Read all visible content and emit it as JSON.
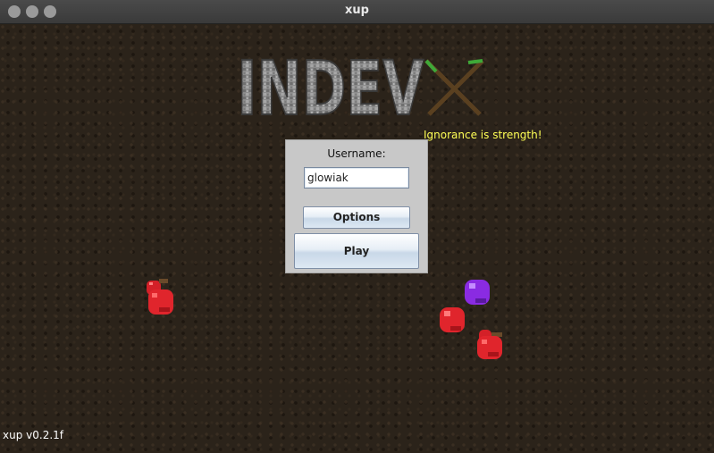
{
  "window": {
    "title": "xup"
  },
  "logo": {
    "text": "INDEV"
  },
  "tagline": "Ignorance is strength!",
  "login": {
    "username_label": "Username:",
    "username_value": "glowiak",
    "options_label": "Options",
    "play_label": "Play"
  },
  "version": "xup v0.2.1f",
  "colors": {
    "background": "#2b231a",
    "tagline": "#ffff55",
    "panel": "#c8c8c8",
    "gem_red": "#e0252c",
    "gem_purple": "#8a2be2"
  },
  "icons": [
    "cobblestone-logo-icon",
    "crossed-sticks-icon",
    "apple-icon",
    "red-gem-icon",
    "purple-gem-icon"
  ]
}
